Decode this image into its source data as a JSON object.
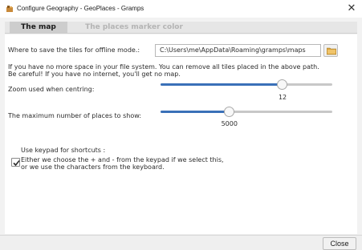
{
  "window": {
    "title": "Configure Geography - GeoPlaces - Gramps",
    "close_glyph": "✕"
  },
  "tabs": [
    {
      "label": "The map",
      "active": true
    },
    {
      "label": "The places marker color",
      "active": false
    }
  ],
  "tiles": {
    "label": "Where to save the tiles for offline mode.:",
    "path_value": "C:\\Users\\me\\AppData\\Roaming\\gramps\\maps",
    "browse_icon": "folder-icon"
  },
  "notes": {
    "line1": "If you have no more space in your file system. You can remove all tiles placed in the above path.",
    "line2": "Be careful! If you have no internet, you'll get no map."
  },
  "zoom": {
    "label": "Zoom used when centring:",
    "value_text": "12",
    "fraction": 0.71
  },
  "max_places": {
    "label": "The maximum number of places to show:",
    "value_text": "5000",
    "fraction": 0.4
  },
  "keypad": {
    "checked": true,
    "line1": "Use keypad for shortcuts :",
    "line2": "Either we choose the + and - from the keypad if we select this,",
    "line3": "or we use the characters from the keyboard."
  },
  "footer": {
    "close_label": "Close"
  },
  "colors": {
    "accent": "#3a70b8",
    "tab_active_bg": "#cdcdcd",
    "tab_inactive_text": "#b4b4b4"
  }
}
